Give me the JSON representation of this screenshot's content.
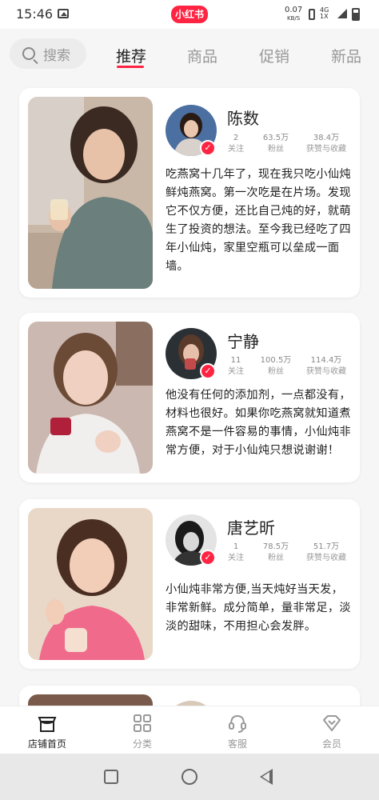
{
  "status_bar": {
    "time": "15:46",
    "app_badge": "小红书",
    "net_speed": "0.07",
    "net_unit": "KB/S",
    "signal_label": "4G",
    "signal_sub": "1X"
  },
  "header": {
    "search_placeholder": "搜索",
    "tabs": [
      {
        "label": "推荐",
        "active": true
      },
      {
        "label": "商品",
        "active": false
      },
      {
        "label": "促销",
        "active": false
      },
      {
        "label": "新品",
        "active": false
      }
    ]
  },
  "cards": [
    {
      "name": "陈数",
      "follow_count": "2",
      "follow_label": "关注",
      "fans_count": "63.5万",
      "fans_label": "粉丝",
      "likes_count": "38.4万",
      "likes_label": "获赞与收藏",
      "description": "吃燕窝十几年了，现在我只吃小仙炖鲜炖燕窝。第一次吃是在片场。发现它不仅方便，还比自己炖的好，就萌生了投资的想法。至今我已经吃了四年小仙炖，家里空瓶可以垒成一面墙。"
    },
    {
      "name": "宁静",
      "follow_count": "11",
      "follow_label": "关注",
      "fans_count": "100.5万",
      "fans_label": "粉丝",
      "likes_count": "114.4万",
      "likes_label": "获赞与收藏",
      "description": "他没有任何的添加剂，一点都没有，材料也很好。如果你吃燕窝就知道煮燕窝不是一件容易的事情，小仙炖非常方便，对于小仙炖只想说谢谢！"
    },
    {
      "name": "唐艺昕",
      "follow_count": "1",
      "follow_label": "关注",
      "fans_count": "78.5万",
      "fans_label": "粉丝",
      "likes_count": "51.7万",
      "likes_label": "获赞与收藏",
      "description": "小仙炖非常方便,当天炖好当天发，非常新鲜。成分简单，量非常足，淡淡的甜味，不用担心会发胖。"
    }
  ],
  "bottom_nav": [
    {
      "label": "店铺首页",
      "icon": "store-icon",
      "active": true
    },
    {
      "label": "分类",
      "icon": "grid-icon",
      "active": false
    },
    {
      "label": "客服",
      "icon": "headset-icon",
      "active": false
    },
    {
      "label": "会员",
      "icon": "diamond-icon",
      "active": false
    }
  ],
  "colors": {
    "accent": "#ff2442"
  }
}
